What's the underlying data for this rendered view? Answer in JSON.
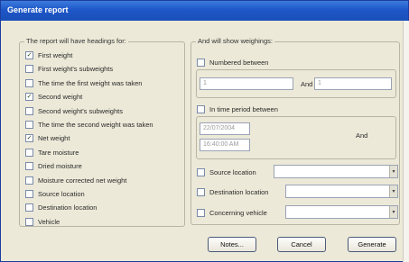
{
  "window": {
    "title": "Generate report"
  },
  "headings_group": {
    "legend": "The report will have headings for:",
    "items": [
      {
        "label": "First weight",
        "checked": true
      },
      {
        "label": "First weight's subweights",
        "checked": false
      },
      {
        "label": "The time the first weight was taken",
        "checked": false
      },
      {
        "label": "Second weight",
        "checked": true
      },
      {
        "label": "Second weight's subweights",
        "checked": false
      },
      {
        "label": "The time the second weight was taken",
        "checked": false
      },
      {
        "label": "Net weight",
        "checked": true
      },
      {
        "label": "Tare moisture",
        "checked": false
      },
      {
        "label": "Dried moisture",
        "checked": false
      },
      {
        "label": "Moisture corrected net weight",
        "checked": false
      },
      {
        "label": "Source location",
        "checked": false
      },
      {
        "label": "Destination location",
        "checked": false
      },
      {
        "label": "Vehicle",
        "checked": false
      }
    ]
  },
  "filters_group": {
    "legend": "And will show weighings:",
    "numbered_between": {
      "label": "Numbered between",
      "checked": false,
      "from_value": "1",
      "and_label": "And",
      "to_value": "1"
    },
    "time_between": {
      "label": "In time period between",
      "checked": false,
      "from_date": "22/07/2004",
      "from_time": "16:40:00 AM",
      "and_label": "And"
    },
    "source": {
      "label": "Source location",
      "checked": false,
      "value": ""
    },
    "destination": {
      "label": "Destination location",
      "checked": false,
      "value": ""
    },
    "vehicle": {
      "label": "Concerning vehicle",
      "checked": false,
      "value": ""
    }
  },
  "buttons": {
    "notes": "Notes...",
    "cancel": "Cancel",
    "generate": "Generate"
  }
}
